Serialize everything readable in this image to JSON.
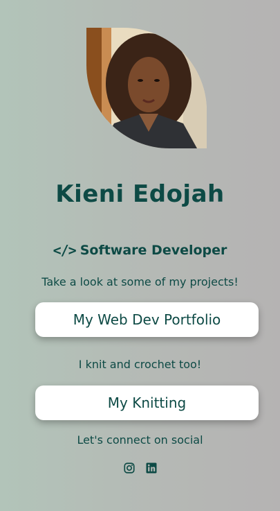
{
  "profile": {
    "name": "Kieni Edojah",
    "role": "Software Developer",
    "role_icon": "code-icon",
    "avatar_icon": "profile-photo"
  },
  "links": {
    "portfolio_caption": "Take a look at some of my projects!",
    "portfolio_label": "My Web Dev Portfolio",
    "knitting_caption": "I knit and crochet too!",
    "knitting_label": "My Knitting"
  },
  "social": {
    "caption": "Let's connect on social",
    "icons": [
      "instagram-icon",
      "linkedin-icon"
    ]
  },
  "colors": {
    "accent": "#0d4a45",
    "button_bg": "#ffffff"
  }
}
